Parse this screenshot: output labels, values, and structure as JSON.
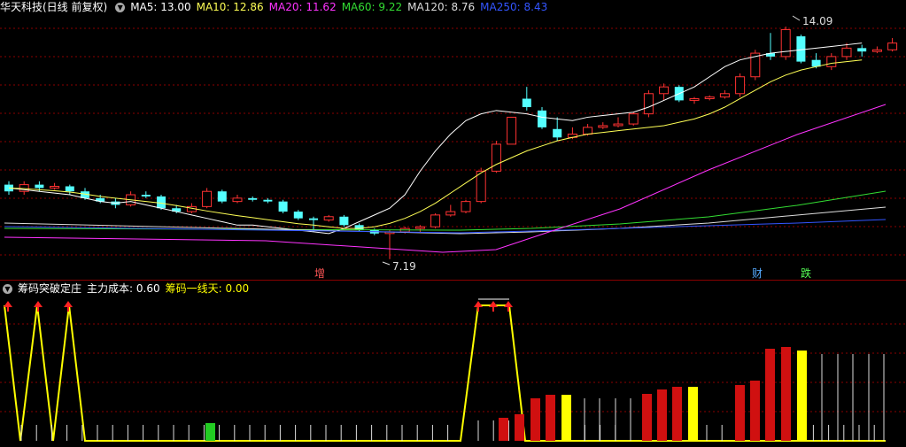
{
  "header": {
    "title": "华天科技(日线 前复权)",
    "collapse_icon": "chevron-down-icon",
    "ma": [
      {
        "label": "MA5: 13.00",
        "color": "#ffffff"
      },
      {
        "label": "MA10: 12.86",
        "color": "#ffff55"
      },
      {
        "label": "MA20: 11.62",
        "color": "#ff33ff"
      },
      {
        "label": "MA60: 9.22",
        "color": "#33dd33"
      },
      {
        "label": "MA120: 8.76",
        "color": "#dddddd"
      },
      {
        "label": "MA250: 8.43",
        "color": "#3355ff"
      }
    ]
  },
  "price_annotations": {
    "high": "14.09",
    "low": "7.19"
  },
  "markers": {
    "zeng": "增",
    "cai": "财",
    "die": "跌"
  },
  "indicator": {
    "name": "筹码突破定庄",
    "cost_label": "主力成本: 0.60",
    "line_label": "筹码一线天: 0.00"
  },
  "colors": {
    "up": "#ff3232",
    "down": "#54ffff",
    "grid": "#8b0000",
    "yellow": "#ffff00",
    "green": "#22cc22"
  },
  "chart_data": {
    "type": "candlestick",
    "price_range": [
      7.19,
      14.09
    ],
    "candles": [
      {
        "o": 9.4,
        "c": 9.2,
        "h": 9.5,
        "l": 9.1
      },
      {
        "o": 9.2,
        "c": 9.4,
        "h": 9.5,
        "l": 9.1
      },
      {
        "o": 9.4,
        "c": 9.3,
        "h": 9.5,
        "l": 9.2
      },
      {
        "o": 9.3,
        "c": 9.35,
        "h": 9.45,
        "l": 9.25
      },
      {
        "o": 9.35,
        "c": 9.2,
        "h": 9.4,
        "l": 9.1
      },
      {
        "o": 9.2,
        "c": 9.0,
        "h": 9.3,
        "l": 8.95
      },
      {
        "o": 9.0,
        "c": 8.9,
        "h": 9.1,
        "l": 8.85
      },
      {
        "o": 8.9,
        "c": 8.8,
        "h": 9.0,
        "l": 8.7
      },
      {
        "o": 8.8,
        "c": 9.1,
        "h": 9.2,
        "l": 8.75
      },
      {
        "o": 9.1,
        "c": 9.05,
        "h": 9.2,
        "l": 9.0
      },
      {
        "o": 9.05,
        "c": 8.7,
        "h": 9.1,
        "l": 8.65
      },
      {
        "o": 8.7,
        "c": 8.6,
        "h": 8.8,
        "l": 8.55
      },
      {
        "o": 8.6,
        "c": 8.75,
        "h": 8.85,
        "l": 8.55
      },
      {
        "o": 8.75,
        "c": 9.2,
        "h": 9.3,
        "l": 8.7
      },
      {
        "o": 9.2,
        "c": 8.9,
        "h": 9.25,
        "l": 8.85
      },
      {
        "o": 8.9,
        "c": 9.0,
        "h": 9.1,
        "l": 8.85
      },
      {
        "o": 9.0,
        "c": 8.95,
        "h": 9.05,
        "l": 8.9
      },
      {
        "o": 8.95,
        "c": 8.9,
        "h": 9.0,
        "l": 8.85
      },
      {
        "o": 8.9,
        "c": 8.6,
        "h": 8.95,
        "l": 8.55
      },
      {
        "o": 8.6,
        "c": 8.4,
        "h": 8.65,
        "l": 8.35
      },
      {
        "o": 8.4,
        "c": 8.35,
        "h": 8.45,
        "l": 8.0
      },
      {
        "o": 8.35,
        "c": 8.45,
        "h": 8.5,
        "l": 8.3
      },
      {
        "o": 8.45,
        "c": 8.2,
        "h": 8.5,
        "l": 8.15
      },
      {
        "o": 8.2,
        "c": 8.05,
        "h": 8.25,
        "l": 8.0
      },
      {
        "o": 8.05,
        "c": 7.95,
        "h": 8.1,
        "l": 7.9
      },
      {
        "o": 7.95,
        "c": 8.0,
        "h": 8.05,
        "l": 7.19
      },
      {
        "o": 8.0,
        "c": 8.1,
        "h": 8.15,
        "l": 7.95
      },
      {
        "o": 8.1,
        "c": 8.15,
        "h": 8.2,
        "l": 8.0
      },
      {
        "o": 8.15,
        "c": 8.5,
        "h": 8.55,
        "l": 8.1
      },
      {
        "o": 8.5,
        "c": 8.6,
        "h": 8.8,
        "l": 8.45
      },
      {
        "o": 8.6,
        "c": 8.9,
        "h": 8.95,
        "l": 8.55
      },
      {
        "o": 8.9,
        "c": 9.8,
        "h": 9.9,
        "l": 8.85
      },
      {
        "o": 9.8,
        "c": 10.6,
        "h": 10.7,
        "l": 9.75
      },
      {
        "o": 10.6,
        "c": 11.4,
        "h": 11.4,
        "l": 11.1
      },
      {
        "o": 11.95,
        "c": 11.7,
        "h": 12.3,
        "l": 11.6
      },
      {
        "o": 11.6,
        "c": 11.1,
        "h": 11.7,
        "l": 11.05
      },
      {
        "o": 11.05,
        "c": 10.8,
        "h": 11.4,
        "l": 10.7
      },
      {
        "o": 10.8,
        "c": 10.9,
        "h": 11.1,
        "l": 10.75
      },
      {
        "o": 10.9,
        "c": 11.1,
        "h": 11.2,
        "l": 10.85
      },
      {
        "o": 11.1,
        "c": 11.15,
        "h": 11.25,
        "l": 11.05
      },
      {
        "o": 11.15,
        "c": 11.2,
        "h": 11.4,
        "l": 11.1
      },
      {
        "o": 11.2,
        "c": 11.5,
        "h": 11.55,
        "l": 11.15
      },
      {
        "o": 11.5,
        "c": 12.1,
        "h": 12.2,
        "l": 11.4
      },
      {
        "o": 12.1,
        "c": 12.3,
        "h": 12.4,
        "l": 11.9
      },
      {
        "o": 12.3,
        "c": 11.9,
        "h": 12.35,
        "l": 11.85
      },
      {
        "o": 11.9,
        "c": 11.95,
        "h": 12.0,
        "l": 11.8
      },
      {
        "o": 11.95,
        "c": 12.0,
        "h": 12.05,
        "l": 11.9
      },
      {
        "o": 12.0,
        "c": 12.1,
        "h": 12.2,
        "l": 11.95
      },
      {
        "o": 12.1,
        "c": 12.6,
        "h": 12.7,
        "l": 12.0
      },
      {
        "o": 12.6,
        "c": 13.3,
        "h": 13.4,
        "l": 12.5
      },
      {
        "o": 13.3,
        "c": 13.2,
        "h": 13.9,
        "l": 13.1
      },
      {
        "o": 13.2,
        "c": 14.0,
        "h": 14.09,
        "l": 13.1
      },
      {
        "o": 13.8,
        "c": 13.05,
        "h": 13.85,
        "l": 13.0
      },
      {
        "o": 13.1,
        "c": 12.9,
        "h": 13.3,
        "l": 12.85
      },
      {
        "o": 12.9,
        "c": 13.2,
        "h": 13.3,
        "l": 12.8
      },
      {
        "o": 13.2,
        "c": 13.45,
        "h": 13.6,
        "l": 13.1
      },
      {
        "o": 13.45,
        "c": 13.35,
        "h": 13.55,
        "l": 13.2
      },
      {
        "o": 13.35,
        "c": 13.4,
        "h": 13.5,
        "l": 13.3
      },
      {
        "o": 13.4,
        "c": 13.6,
        "h": 13.75,
        "l": 13.35
      }
    ],
    "moving_averages": [
      {
        "name": "MA5",
        "color": "#ffffff",
        "values": [
          9.3,
          9.25,
          9.2,
          9.15,
          9.1,
          9.0,
          8.9,
          8.85,
          8.9,
          8.8,
          8.7,
          8.6,
          8.5,
          8.4,
          8.3,
          8.2,
          8.2,
          8.15,
          8.1,
          8.05,
          8.0,
          7.95,
          8.1,
          8.3,
          8.5,
          8.7,
          9.1,
          9.8,
          10.4,
          10.9,
          11.3,
          11.5,
          11.6,
          11.55,
          11.5,
          11.4,
          11.35,
          11.3,
          11.4,
          11.45,
          11.5,
          11.55,
          11.7,
          11.9,
          12.1,
          12.3,
          12.6,
          12.9,
          13.1,
          13.2,
          13.3,
          13.35,
          13.4,
          13.45,
          13.5,
          13.55,
          13.6
        ]
      },
      {
        "name": "MA10",
        "color": "#ffff55",
        "values": [
          9.3,
          9.28,
          9.25,
          9.22,
          9.18,
          9.12,
          9.05,
          9.0,
          8.95,
          8.9,
          8.85,
          8.78,
          8.7,
          8.62,
          8.55,
          8.48,
          8.42,
          8.36,
          8.3,
          8.24,
          8.2,
          8.15,
          8.1,
          8.1,
          8.15,
          8.25,
          8.4,
          8.6,
          8.85,
          9.15,
          9.45,
          9.75,
          10.0,
          10.2,
          10.4,
          10.55,
          10.7,
          10.8,
          10.9,
          10.95,
          11.0,
          11.05,
          11.1,
          11.15,
          11.25,
          11.35,
          11.5,
          11.7,
          11.95,
          12.2,
          12.45,
          12.65,
          12.8,
          12.9,
          13.0,
          13.05,
          13.1
        ]
      }
    ],
    "indicator_bars": [
      {
        "type": "yellow_line",
        "points": [
          [
            0,
            0.85
          ],
          [
            1,
            0.1
          ],
          [
            2,
            0.85
          ],
          [
            3,
            0.1
          ],
          [
            4,
            0.85
          ],
          [
            5,
            0.1
          ]
        ]
      }
    ]
  }
}
